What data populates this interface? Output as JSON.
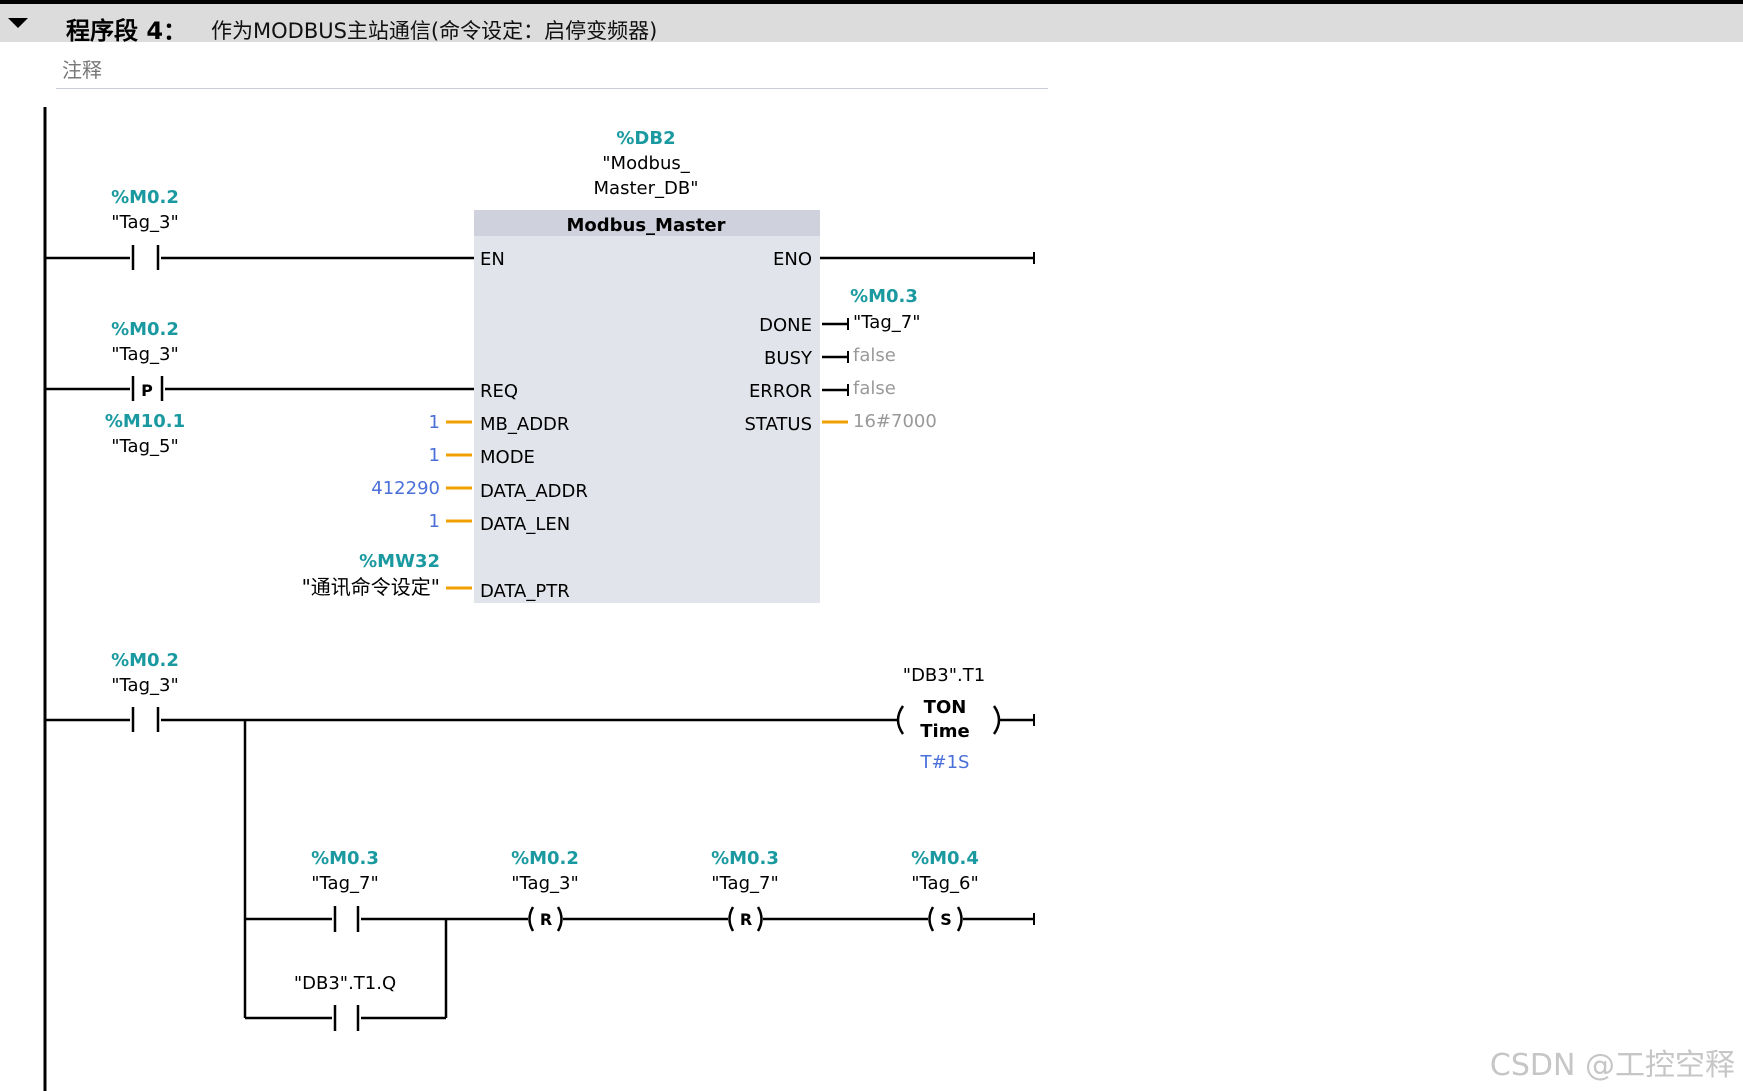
{
  "network": {
    "title": "程序段 4：",
    "description": "作为MODBUS主站通信(命令设定：启停变频器)",
    "comment_label": "注释"
  },
  "rung1": {
    "contact1": {
      "address": "%M0.2",
      "tag": "\"Tag_3\""
    },
    "contact2": {
      "address": "%M0.2",
      "tag": "\"Tag_3\"",
      "type_label": "P"
    },
    "contact2_edge": {
      "address": "%M10.1",
      "tag": "\"Tag_5\""
    },
    "block": {
      "instance_address": "%DB2",
      "instance_name_line1": "\"Modbus_",
      "instance_name_line2": "Master_DB\"",
      "title": "Modbus_Master",
      "inputs": [
        "EN",
        "REQ",
        "MB_ADDR",
        "MODE",
        "DATA_ADDR",
        "DATA_LEN",
        "DATA_PTR"
      ],
      "outputs": [
        "ENO",
        "DONE",
        "BUSY",
        "ERROR",
        "STATUS"
      ]
    },
    "input_values": {
      "mb_addr": "1",
      "mode": "1",
      "data_addr": "412290",
      "data_len": "1",
      "data_ptr_address": "%MW32",
      "data_ptr_tag": "\"通讯命令设定\""
    },
    "output_values": {
      "done_address": "%M0.3",
      "done_tag": "\"Tag_7\"",
      "busy": "false",
      "error": "false",
      "status": "16#7000"
    }
  },
  "rung2": {
    "contact": {
      "address": "%M0.2",
      "tag": "\"Tag_3\""
    },
    "timer": {
      "instance": "\"DB3\".T1",
      "type": "TON",
      "unit": "Time",
      "preset": "T#1S"
    },
    "branch_contact1": {
      "address": "%M0.3",
      "tag": "\"Tag_7\""
    },
    "branch_contact2": {
      "tag": "\"DB3\".T1.Q"
    },
    "coil1": {
      "address": "%M0.2",
      "tag": "\"Tag_3\"",
      "type": "R"
    },
    "coil2": {
      "address": "%M0.3",
      "tag": "\"Tag_7\"",
      "type": "R"
    },
    "coil3": {
      "address": "%M0.4",
      "tag": "\"Tag_6\"",
      "type": "S"
    }
  },
  "watermark": "CSDN @工控空释",
  "colors": {
    "address": "#1a9aa0",
    "constant": "#4a6fd8",
    "wire": "#000000",
    "param_wire": "#f0a000",
    "block_fill": "#e2e4ec",
    "block_header": "#cfd2dc",
    "muted": "#999999"
  }
}
